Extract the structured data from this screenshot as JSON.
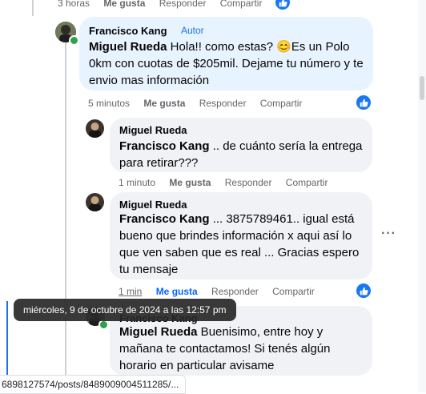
{
  "top_actions": {
    "time": "3 horas",
    "like": "Me gusta",
    "reply": "Responder",
    "share": "Compartir"
  },
  "comments": [
    {
      "author": "Francisco Kang",
      "badge": "Autor",
      "mention": "Miguel Rueda",
      "text": " Hola!! como estas? 😊Es un Polo 0km con cuotas de $205mil. Dejame tu número y te envio mas información",
      "time": "5 minutos",
      "like": "Me gusta",
      "reply": "Responder",
      "share": "Compartir"
    },
    {
      "author": "Miguel Rueda",
      "mention": "Francisco Kang",
      "text": " .. de cuánto sería la entrega para retirar???",
      "time": "1 minuto",
      "like": "Me gusta",
      "reply": "Responder",
      "share": "Compartir"
    },
    {
      "author": "Miguel Rueda",
      "mention": "Francisco Kang",
      "text": " ... 3875789461.. igual está bueno que brindes información x aqui así lo que ven saben que es real ... Gracias espero tu mensaje",
      "time": "1 min",
      "like": "Me gusta",
      "reply": "Responder",
      "share": "Compartir"
    },
    {
      "author": "Francisco Kang",
      "mention": "Miguel Rueda",
      "text": " Buenisimo, entre hoy y mañana te contactamos! Si tenés algún horario en particular avisame"
    }
  ],
  "tooltip": "miércoles, 9 de octubre de 2024 a las 12:57 pm",
  "status_url": "6898127574/posts/8489009004511285/...",
  "colors": {
    "accent": "#1877f2",
    "bubble": "#f0f2f5",
    "highlight": "#e7f3ff",
    "online": "#31a24c"
  },
  "icons": {
    "like": "thumbs-up-icon",
    "more": "more-options-icon"
  }
}
